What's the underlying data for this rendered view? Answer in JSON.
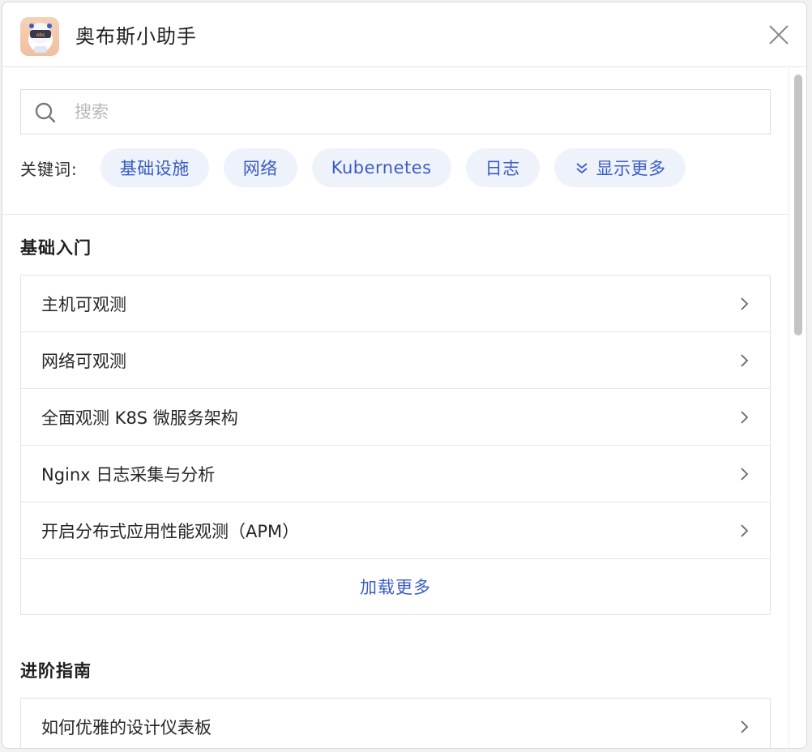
{
  "app": {
    "title": "奥布斯小助手",
    "icon": "robot-assistant-icon"
  },
  "search": {
    "placeholder": "搜索",
    "value": ""
  },
  "keywords": {
    "label": "关键词:",
    "chips": [
      "基础设施",
      "网络",
      "Kubernetes",
      "日志"
    ],
    "more_label": "显示更多"
  },
  "sections": [
    {
      "title": "基础入门",
      "items": [
        "主机可观测",
        "网络可观测",
        "全面观测 K8S 微服务架构",
        "Nginx 日志采集与分析",
        "开启分布式应用性能观测（APM）"
      ],
      "load_more": "加载更多"
    },
    {
      "title": "进阶指南",
      "items": [
        "如何优雅的设计仪表板"
      ]
    }
  ],
  "colors": {
    "accent": "#3b5cc6",
    "chip_bg": "#eef2fb",
    "border": "#e2e2e2"
  }
}
